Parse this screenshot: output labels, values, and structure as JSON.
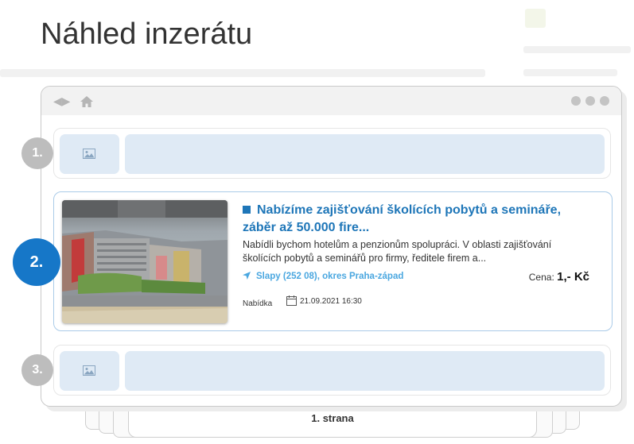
{
  "page": {
    "title": "Náhled inzerátu"
  },
  "browser": {
    "nav_icon": "back-forward-arrows-icon",
    "home_icon": "home-icon",
    "window_dots": [
      "dot-1",
      "dot-2",
      "dot-3"
    ]
  },
  "slots": [
    {
      "number": "1.",
      "image_icon": "image-icon"
    },
    {
      "number": "3.",
      "image_icon": "image-icon"
    }
  ],
  "listing": {
    "number": "2.",
    "title": "Nabízíme zajišťování školících pobytů a semináře, záběr až 50.000 fire...",
    "description": "Nabídli bychom hotelům a penzionům spolupráci. V oblasti zajišťování školících pobytů a seminářů pro firmy, ředitele firem a...",
    "location": "Slapy (252 08), okres Praha-západ",
    "price_label": "Cena:",
    "price_value": "1,- Kč",
    "type": "Nabídka",
    "date": "21.09.2021 16:30"
  },
  "pagination": {
    "label": "1. strana"
  },
  "colors": {
    "accent": "#1e76b8",
    "badge_active": "#1677c8",
    "badge_inactive": "#bdbdbd",
    "placeholder": "#dfeaf5",
    "location": "#4aa7e0"
  }
}
